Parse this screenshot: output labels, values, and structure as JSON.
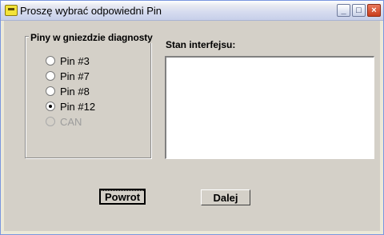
{
  "window": {
    "title": "Proszę wybrać odpowiedni Pin"
  },
  "titlebar_buttons": {
    "minimize": "_",
    "maximize": "□",
    "close": "×"
  },
  "groupbox": {
    "title": "Piny w gniezdzie diagnosty",
    "options": [
      {
        "label": "Pin #3",
        "selected": false,
        "enabled": true
      },
      {
        "label": "Pin #7",
        "selected": false,
        "enabled": true
      },
      {
        "label": "Pin #8",
        "selected": false,
        "enabled": true
      },
      {
        "label": "Pin #12",
        "selected": true,
        "enabled": true
      },
      {
        "label": "CAN",
        "selected": false,
        "enabled": false
      }
    ]
  },
  "status": {
    "label": "Stan interfejsu:",
    "value": ""
  },
  "buttons": {
    "back": "Powrot",
    "next": "Dalej"
  }
}
